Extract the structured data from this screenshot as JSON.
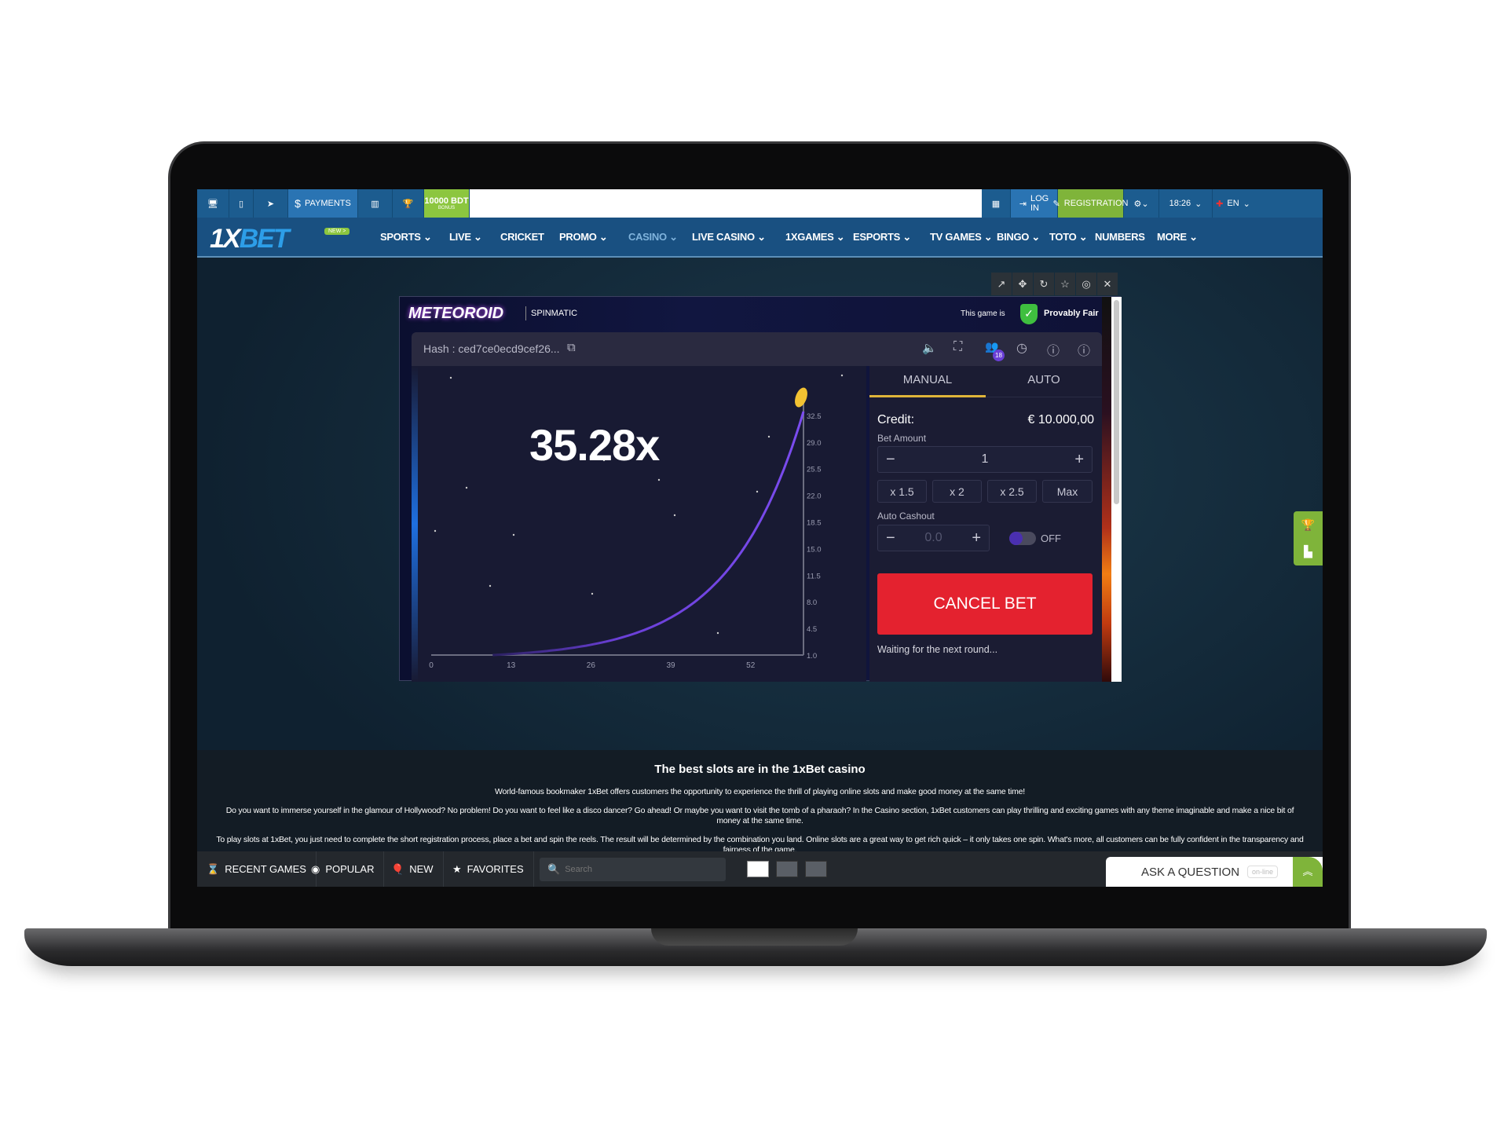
{
  "topbar": {
    "payments": "PAYMENTS",
    "bonus_amount": "10000 BDT",
    "bonus_label": "BONUS",
    "login": "LOG IN",
    "registration": "REGISTRATION",
    "time": "18:26",
    "language": "EN"
  },
  "nav": {
    "logo": "1XBET",
    "new_badge": "NEW >",
    "items": [
      "SPORTS",
      "LIVE",
      "CRICKET",
      "PROMO",
      "CASINO",
      "LIVE CASINO",
      "1XGAMES",
      "ESPORTS",
      "TV GAMES",
      "BINGO",
      "TOTO",
      "NUMBERS",
      "MORE"
    ],
    "active": "CASINO"
  },
  "game": {
    "title": "METEOROID",
    "provider": "SPINMATIC",
    "fair_prefix": "This game is",
    "fair_label": "Provably Fair",
    "hash": "Hash : ced7ce0ecd9cef26...",
    "players_count": "18",
    "multiplier": "35.28x",
    "tabs": [
      "MANUAL",
      "AUTO"
    ],
    "active_tab": "MANUAL",
    "credit_label": "Credit:",
    "credit_value": "€ 10.000,00",
    "bet_amount_label": "Bet Amount",
    "bet_amount": "1",
    "quick_bets": [
      "x 1.5",
      "x 2",
      "x 2.5",
      "Max"
    ],
    "auto_cashout_label": "Auto Cashout",
    "auto_cashout_value": "0.0",
    "auto_toggle": "OFF",
    "cancel_bet": "CANCEL BET",
    "status": "Waiting for the next round...",
    "colors": {
      "cancel": "#e4222f",
      "curve": "#6a3fd6",
      "tab_underline": "#e0b53a",
      "rocket": "#f2c232"
    }
  },
  "chart_data": {
    "type": "line",
    "x_ticks": [
      "0",
      "13",
      "26",
      "39",
      "52"
    ],
    "y_ticks": [
      "1.0",
      "4.5",
      "8.0",
      "11.5",
      "15.0",
      "18.5",
      "22.0",
      "25.5",
      "29.0",
      "32.5"
    ],
    "xlim": [
      0,
      60.6
    ],
    "ylim": [
      1,
      33
    ],
    "current_multiplier": 35.28
  },
  "content": {
    "title": "The best slots are in the 1xBet casino",
    "paragraphs": [
      "World-famous bookmaker 1xBet offers customers the opportunity to experience the thrill of playing online slots and make good money at the same time!",
      "Do you want to immerse yourself in the glamour of Hollywood? No problem! Do you want to feel like a disco dancer? Go ahead! Or maybe you want to visit the tomb of a pharaoh? In the Casino section, 1xBet customers can play thrilling and exciting games with any theme imaginable and make a nice bit of money at the same time.",
      "To play slots at 1xBet, you just need to complete the short registration process, place a bet and spin the reels. The result will be determined by the combination you land. Online slots are a great way to get rich quick – it only takes one spin. What's more, all customers can be fully confident in the transparency and fairness of the game."
    ]
  },
  "bottom": {
    "recent": "RECENT GAMES",
    "popular": "POPULAR",
    "new": "NEW",
    "favorites": "FAVORITES",
    "search_placeholder": "Search",
    "ask": "ASK A QUESTION",
    "online": "on-line"
  }
}
